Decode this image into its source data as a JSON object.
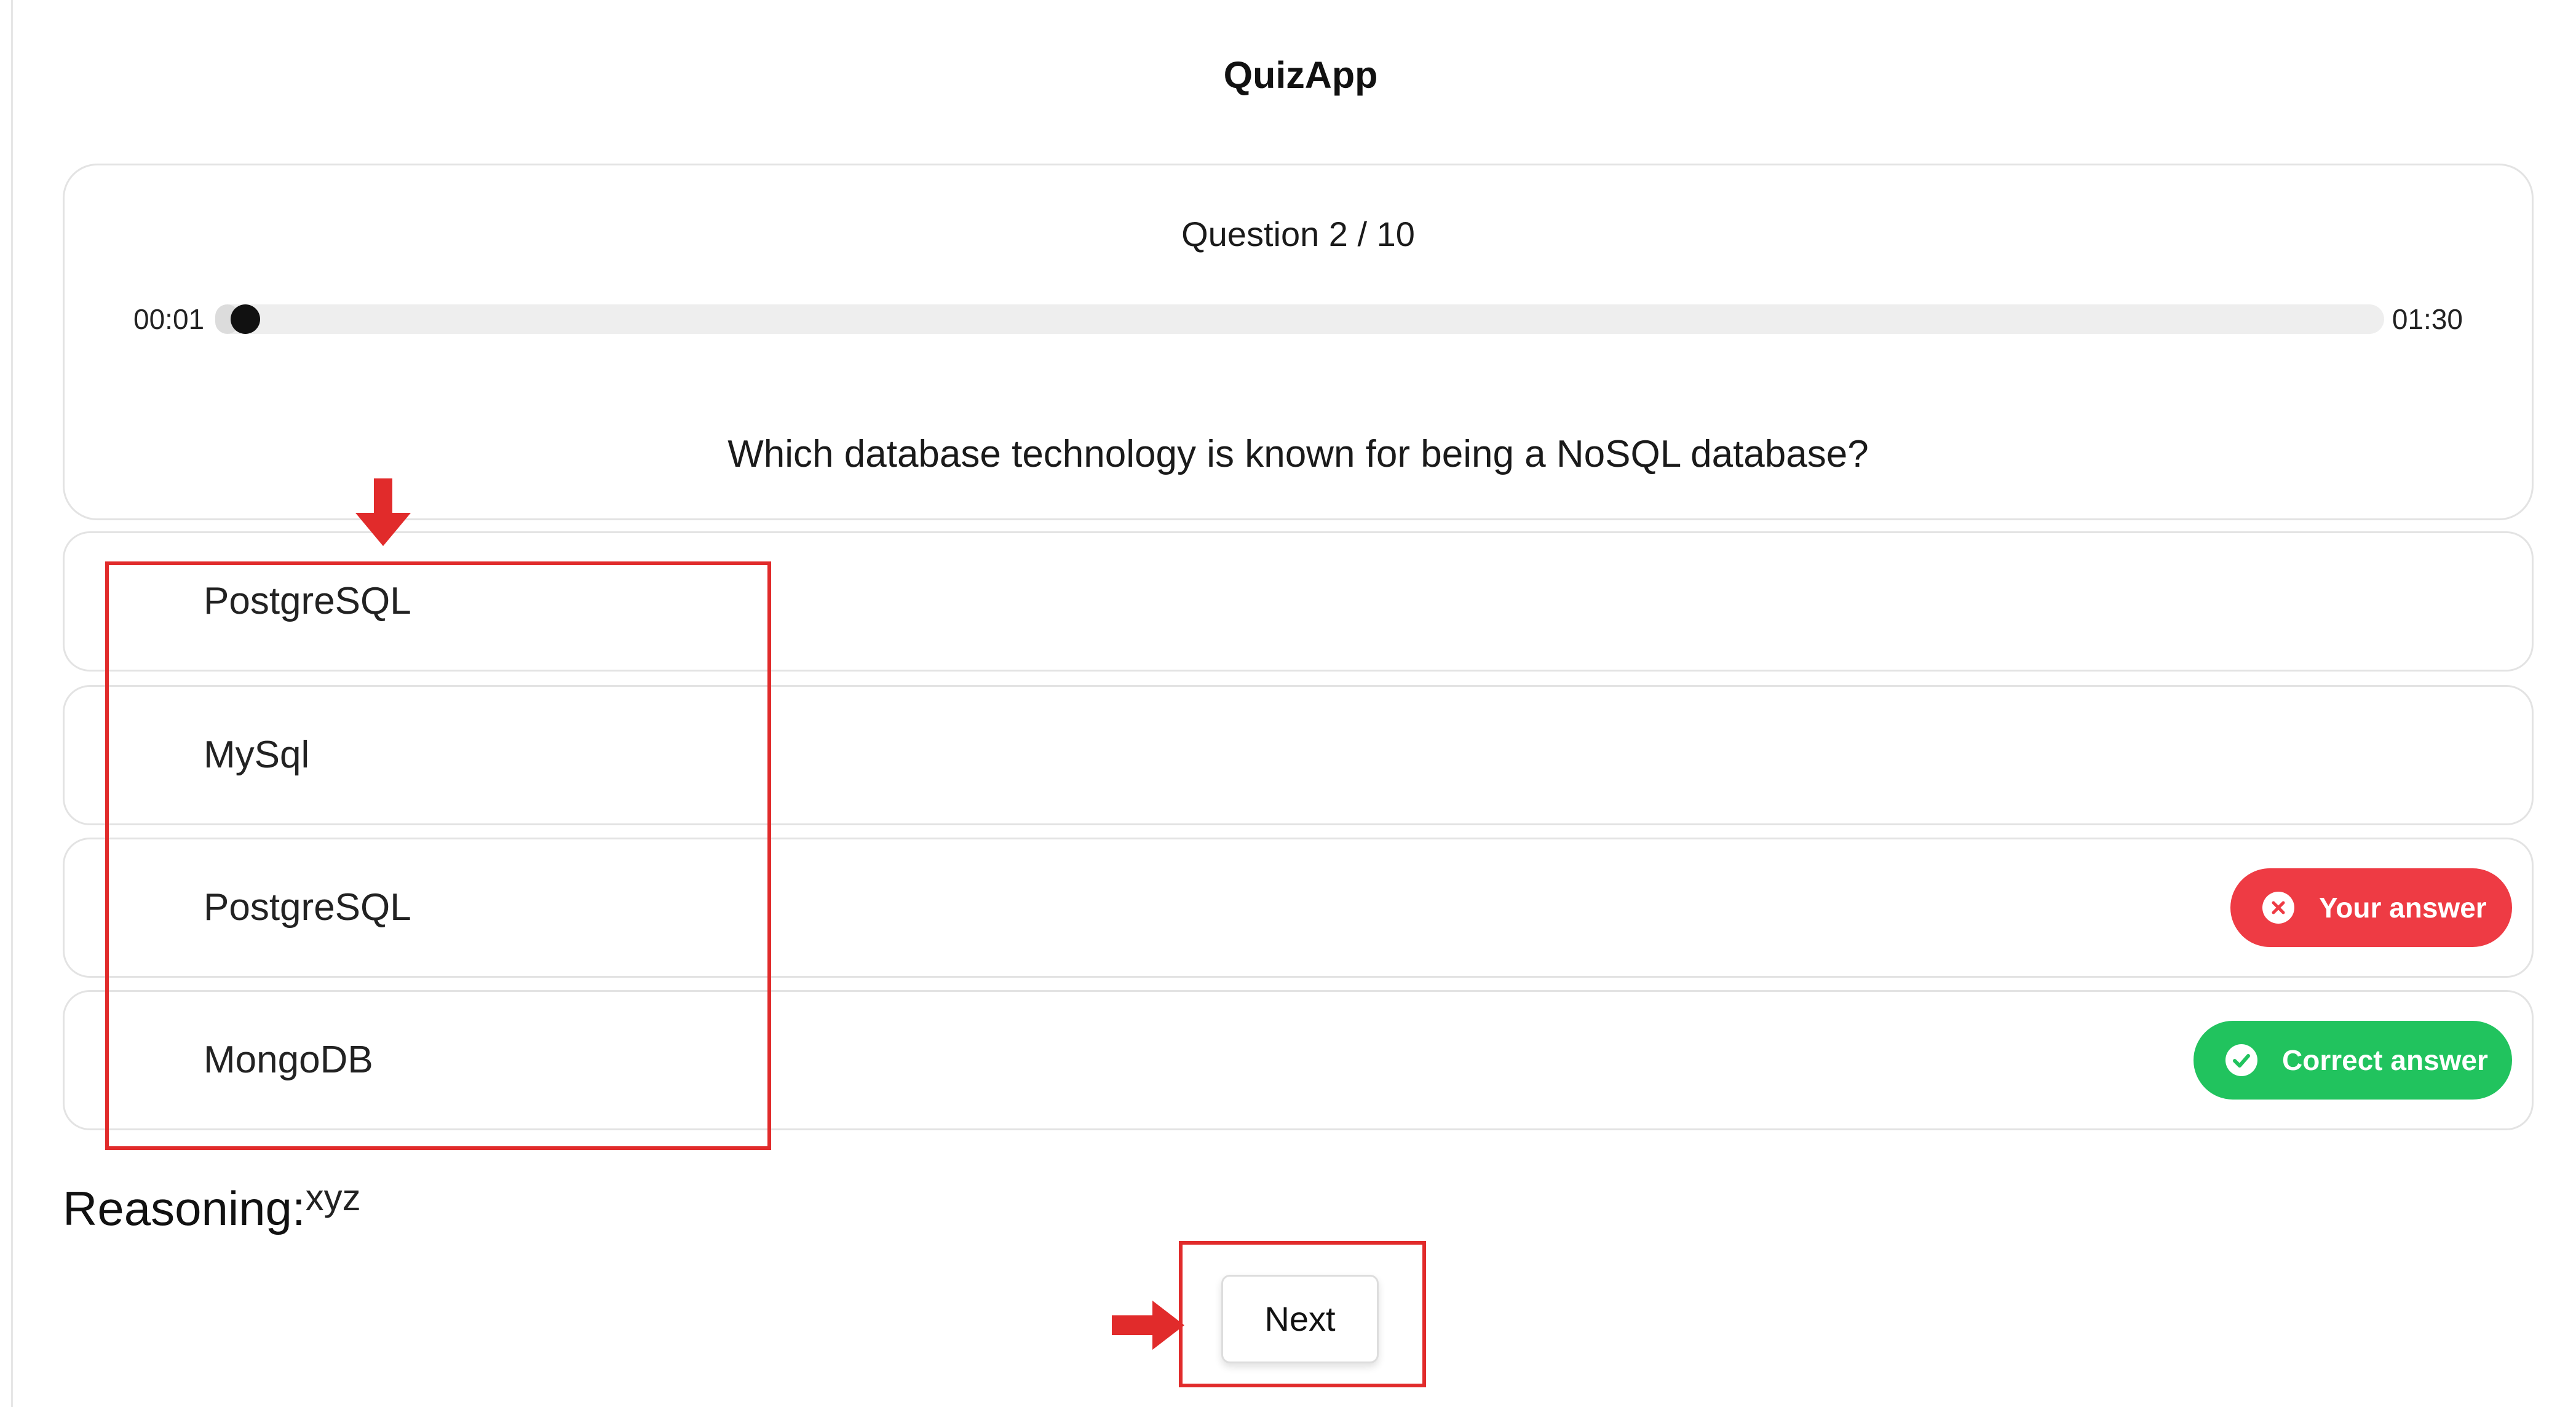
{
  "app": {
    "title": "QuizApp"
  },
  "quiz": {
    "counter": "Question 2 / 10",
    "timer": {
      "elapsed": "00:01",
      "total": "01:30",
      "progress_fraction": 0.011
    },
    "question": "Which database technology is known for being a NoSQL database?",
    "options": [
      {
        "label": "PostgreSQL",
        "status": "none"
      },
      {
        "label": "MySql",
        "status": "none"
      },
      {
        "label": "PostgreSQL",
        "status": "your-answer"
      },
      {
        "label": "MongoDB",
        "status": "correct-answer"
      }
    ],
    "badges": {
      "your_answer": "Your answer",
      "correct_answer": "Correct answer"
    },
    "reasoning": {
      "label": "Reasoning:",
      "value": "xyz"
    },
    "next_label": "Next"
  },
  "colors": {
    "wrong": "#ee3b44",
    "correct": "#21c35e",
    "annotation": "#e12b2b",
    "border": "#e3e3e3"
  },
  "icons": {
    "wrong_badge": "x-circle-icon",
    "correct_badge": "check-circle-icon",
    "annotation_down": "arrow-down-icon",
    "annotation_right": "arrow-right-icon"
  }
}
